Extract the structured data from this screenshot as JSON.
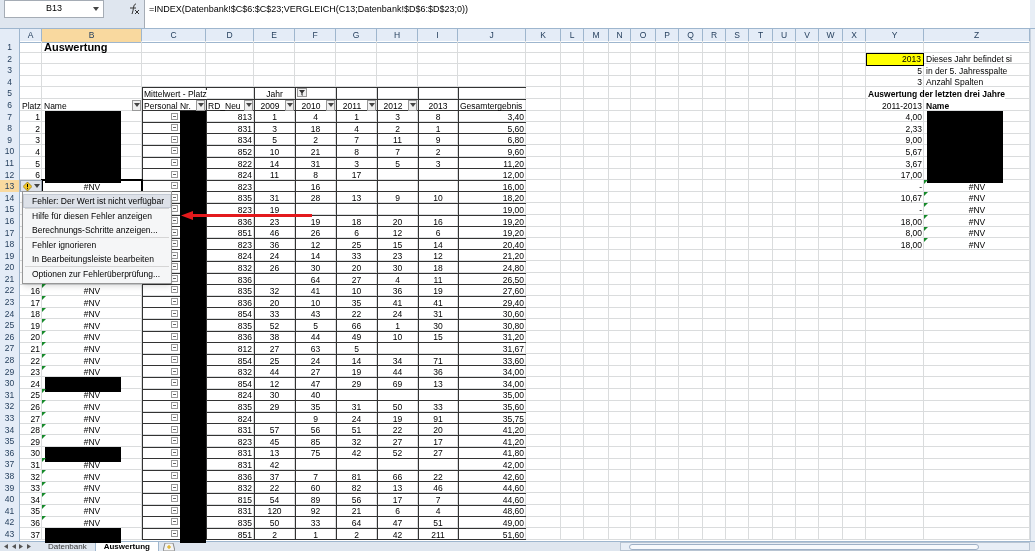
{
  "formula_bar": {
    "name_box": "B13",
    "formula": "=INDEX(Datenbank!$C$6:$C$23;VERGLEICH(C13;Datenbank!$D$6:$D$23;0))"
  },
  "columns": [
    {
      "label": "A",
      "selected": false
    },
    {
      "label": "B",
      "selected": true
    },
    {
      "label": "C",
      "selected": false
    },
    {
      "label": "D",
      "selected": false
    },
    {
      "label": "E",
      "selected": false
    },
    {
      "label": "F",
      "selected": false
    },
    {
      "label": "G",
      "selected": false
    },
    {
      "label": "H",
      "selected": false
    },
    {
      "label": "I",
      "selected": false
    },
    {
      "label": "J",
      "selected": false
    },
    {
      "label": "K",
      "selected": false
    },
    {
      "label": "L",
      "selected": false
    },
    {
      "label": "M",
      "selected": false
    },
    {
      "label": "N",
      "selected": false
    },
    {
      "label": "O",
      "selected": false
    },
    {
      "label": "P",
      "selected": false
    },
    {
      "label": "Q",
      "selected": false
    },
    {
      "label": "R",
      "selected": false
    },
    {
      "label": "S",
      "selected": false
    },
    {
      "label": "T",
      "selected": false
    },
    {
      "label": "U",
      "selected": false
    },
    {
      "label": "V",
      "selected": false
    },
    {
      "label": "W",
      "selected": false
    },
    {
      "label": "X",
      "selected": false
    },
    {
      "label": "Y",
      "selected": false
    },
    {
      "label": "Z",
      "selected": false
    }
  ],
  "row_numbers": [
    {
      "label": "1",
      "selected": false
    },
    {
      "label": "2",
      "selected": false
    },
    {
      "label": "3",
      "selected": false
    },
    {
      "label": "4",
      "selected": false
    },
    {
      "label": "5",
      "selected": false
    },
    {
      "label": "6",
      "selected": false
    },
    {
      "label": "7",
      "selected": false
    },
    {
      "label": "8",
      "selected": false
    },
    {
      "label": "9",
      "selected": false
    },
    {
      "label": "10",
      "selected": false
    },
    {
      "label": "11",
      "selected": false
    },
    {
      "label": "12",
      "selected": false
    },
    {
      "label": "13",
      "selected": true
    },
    {
      "label": "14",
      "selected": false
    },
    {
      "label": "15",
      "selected": false
    },
    {
      "label": "16",
      "selected": false
    },
    {
      "label": "17",
      "selected": false
    },
    {
      "label": "18",
      "selected": false
    },
    {
      "label": "19",
      "selected": false
    },
    {
      "label": "20",
      "selected": false
    },
    {
      "label": "21",
      "selected": false
    },
    {
      "label": "22",
      "selected": false
    },
    {
      "label": "23",
      "selected": false
    },
    {
      "label": "24",
      "selected": false
    },
    {
      "label": "25",
      "selected": false
    },
    {
      "label": "26",
      "selected": false
    },
    {
      "label": "27",
      "selected": false
    },
    {
      "label": "28",
      "selected": false
    },
    {
      "label": "29",
      "selected": false
    },
    {
      "label": "30",
      "selected": false
    },
    {
      "label": "31",
      "selected": false
    },
    {
      "label": "32",
      "selected": false
    },
    {
      "label": "33",
      "selected": false
    },
    {
      "label": "34",
      "selected": false
    },
    {
      "label": "35",
      "selected": false
    },
    {
      "label": "36",
      "selected": false
    },
    {
      "label": "37",
      "selected": false
    },
    {
      "label": "38",
      "selected": false
    },
    {
      "label": "39",
      "selected": false
    },
    {
      "label": "40",
      "selected": false
    },
    {
      "label": "41",
      "selected": false
    },
    {
      "label": "42",
      "selected": false
    },
    {
      "label": "43",
      "selected": false
    }
  ],
  "sheet": {
    "title": "Auswertung"
  },
  "pivot": {
    "header_label": "Mittelwert - Platz",
    "year_label": "Jahr",
    "fields": [
      {
        "label": "Platz",
        "dropdown": false
      },
      {
        "label": "Name",
        "dropdown": true
      },
      {
        "label": "Personal Nr.",
        "dropdown": true
      },
      {
        "label": "RD_Neu",
        "dropdown": true
      },
      {
        "label": "2009",
        "dropdown": true
      },
      {
        "label": "2010",
        "dropdown": true
      },
      {
        "label": "2011",
        "dropdown": true
      },
      {
        "label": "2012",
        "dropdown": true
      },
      {
        "label": "2013",
        "dropdown": false
      },
      {
        "label": "Gesamtergebnis",
        "dropdown": false
      }
    ]
  },
  "rows": [
    {
      "platz": "1",
      "name_redacted": true,
      "id_redacted": true,
      "rd_neu": "813",
      "year_1": "1",
      "year_2": "4",
      "year_3": "1",
      "year_4": "3",
      "year_5": "8",
      "total": "3,40"
    },
    {
      "platz": "2",
      "name_redacted": true,
      "id_redacted": true,
      "rd_neu": "831",
      "year_1": "3",
      "year_2": "18",
      "year_3": "4",
      "year_4": "2",
      "year_5": "1",
      "total": "5,60"
    },
    {
      "platz": "3",
      "name_redacted": true,
      "id_redacted": true,
      "rd_neu": "834",
      "year_1": "5",
      "year_2": "2",
      "year_3": "7",
      "year_4": "11",
      "year_5": "9",
      "total": "6,80"
    },
    {
      "platz": "4",
      "name_redacted": true,
      "id_redacted": true,
      "rd_neu": "852",
      "year_1": "10",
      "year_2": "21",
      "year_3": "8",
      "year_4": "7",
      "year_5": "2",
      "total": "9,60"
    },
    {
      "platz": "5",
      "name_redacted": true,
      "id_redacted": true,
      "rd_neu": "822",
      "year_1": "14",
      "year_2": "31",
      "year_3": "3",
      "year_4": "5",
      "year_5": "3",
      "total": "11,20"
    },
    {
      "platz": "6",
      "name_redacted": true,
      "id_redacted": true,
      "rd_neu": "824",
      "year_1": "11",
      "year_2": "8",
      "year_3": "17",
      "total": "12,00"
    },
    {
      "name": "#NV",
      "warning": false,
      "id_redacted": true,
      "rd_neu": "823",
      "year_2": "16",
      "total": "16,00"
    },
    {
      "id_redacted": true,
      "rd_neu": "835",
      "year_1": "31",
      "year_2": "28",
      "year_3": "13",
      "year_4": "9",
      "year_5": "10",
      "total": "18,20"
    },
    {
      "id_redacted": true,
      "rd_neu": "823",
      "year_1": "19",
      "total": "19,00"
    },
    {
      "id_redacted": true,
      "rd_neu": "836",
      "year_1": "23",
      "year_2": "19",
      "year_3": "18",
      "year_4": "20",
      "year_5": "16",
      "total": "19,20"
    },
    {
      "id_redacted": true,
      "rd_neu": "851",
      "year_1": "46",
      "year_2": "26",
      "year_3": "6",
      "year_4": "12",
      "year_5": "6",
      "total": "19,20"
    },
    {
      "id_redacted": true,
      "rd_neu": "823",
      "year_1": "36",
      "year_2": "12",
      "year_3": "25",
      "year_4": "15",
      "year_5": "14",
      "total": "20,40"
    },
    {
      "id_redacted": true,
      "rd_neu": "824",
      "year_1": "24",
      "year_2": "14",
      "year_3": "33",
      "year_4": "23",
      "year_5": "12",
      "total": "21,20"
    },
    {
      "id_redacted": true,
      "rd_neu": "832",
      "year_1": "26",
      "year_2": "30",
      "year_3": "20",
      "year_4": "30",
      "year_5": "18",
      "total": "24,80"
    },
    {
      "id_redacted": true,
      "rd_neu": "836",
      "year_2": "64",
      "year_3": "27",
      "year_4": "4",
      "year_5": "11",
      "total": "26,50"
    },
    {
      "platz": "16",
      "name": "#NV",
      "warning": true,
      "id_redacted": true,
      "rd_neu": "835",
      "year_1": "32",
      "year_2": "41",
      "year_3": "10",
      "year_4": "36",
      "year_5": "19",
      "total": "27,60"
    },
    {
      "platz": "17",
      "name": "#NV",
      "warning": true,
      "id_redacted": true,
      "rd_neu": "836",
      "year_1": "20",
      "year_2": "10",
      "year_3": "35",
      "year_4": "41",
      "year_5": "41",
      "total": "29,40"
    },
    {
      "platz": "18",
      "name": "#NV",
      "warning": true,
      "id_redacted": true,
      "rd_neu": "854",
      "year_1": "33",
      "year_2": "43",
      "year_3": "22",
      "year_4": "24",
      "year_5": "31",
      "total": "30,60"
    },
    {
      "platz": "19",
      "name": "#NV",
      "warning": true,
      "id_redacted": true,
      "rd_neu": "835",
      "year_1": "52",
      "year_2": "5",
      "year_3": "66",
      "year_4": "1",
      "year_5": "30",
      "total": "30,80"
    },
    {
      "platz": "20",
      "name": "#NV",
      "warning": true,
      "id_redacted": true,
      "rd_neu": "836",
      "year_1": "38",
      "year_2": "44",
      "year_3": "49",
      "year_4": "10",
      "year_5": "15",
      "total": "31,20"
    },
    {
      "platz": "21",
      "name": "#NV",
      "warning": true,
      "id_redacted": true,
      "rd_neu": "812",
      "year_1": "27",
      "year_2": "63",
      "year_3": "5",
      "total": "31,67"
    },
    {
      "platz": "22",
      "name": "#NV",
      "warning": true,
      "id_redacted": true,
      "rd_neu": "854",
      "year_1": "25",
      "year_2": "24",
      "year_3": "14",
      "year_4": "34",
      "year_5": "71",
      "total": "33,60"
    },
    {
      "platz": "23",
      "name": "#NV",
      "warning": true,
      "id_redacted": true,
      "rd_neu": "832",
      "year_1": "44",
      "year_2": "27",
      "year_3": "19",
      "year_4": "44",
      "year_5": "36",
      "total": "34,00"
    },
    {
      "platz": "24",
      "name_redacted": true,
      "id_redacted": true,
      "rd_neu": "854",
      "year_1": "12",
      "year_2": "47",
      "year_3": "29",
      "year_4": "69",
      "year_5": "13",
      "total": "34,00"
    },
    {
      "platz": "25",
      "name": "#NV",
      "warning": true,
      "id_redacted": true,
      "rd_neu": "824",
      "year_1": "30",
      "year_2": "40",
      "total": "35,00"
    },
    {
      "platz": "26",
      "name": "#NV",
      "warning": true,
      "id_redacted": true,
      "rd_neu": "835",
      "year_1": "29",
      "year_2": "35",
      "year_3": "31",
      "year_4": "50",
      "year_5": "33",
      "total": "35,60"
    },
    {
      "platz": "27",
      "name": "#NV",
      "warning": true,
      "id_redacted": true,
      "rd_neu": "824",
      "year_2": "9",
      "year_3": "24",
      "year_4": "19",
      "year_5": "91",
      "total": "35,75"
    },
    {
      "platz": "28",
      "name": "#NV",
      "warning": true,
      "id_redacted": true,
      "rd_neu": "831",
      "year_1": "57",
      "year_2": "56",
      "year_3": "51",
      "year_4": "22",
      "year_5": "20",
      "total": "41,20"
    },
    {
      "platz": "29",
      "name": "#NV",
      "warning": true,
      "id_redacted": true,
      "rd_neu": "823",
      "year_1": "45",
      "year_2": "85",
      "year_3": "32",
      "year_4": "27",
      "year_5": "17",
      "total": "41,20"
    },
    {
      "platz": "30",
      "name_redacted": true,
      "id_redacted": true,
      "rd_neu": "831",
      "year_1": "13",
      "year_2": "75",
      "year_3": "42",
      "year_4": "52",
      "year_5": "27",
      "total": "41,80"
    },
    {
      "platz": "31",
      "name": "#NV",
      "warning": true,
      "id_redacted": true,
      "rd_neu": "831",
      "year_1": "42",
      "total": "42,00"
    },
    {
      "platz": "32",
      "name": "#NV",
      "warning": true,
      "id_redacted": true,
      "rd_neu": "836",
      "year_1": "37",
      "year_2": "7",
      "year_3": "81",
      "year_4": "66",
      "year_5": "22",
      "total": "42,60"
    },
    {
      "platz": "33",
      "name": "#NV",
      "warning": true,
      "id_redacted": true,
      "rd_neu": "832",
      "year_1": "22",
      "year_2": "60",
      "year_3": "82",
      "year_4": "13",
      "year_5": "46",
      "total": "44,60"
    },
    {
      "platz": "34",
      "name": "#NV",
      "warning": true,
      "id_redacted": true,
      "rd_neu": "815",
      "year_1": "54",
      "year_2": "89",
      "year_3": "56",
      "year_4": "17",
      "year_5": "7",
      "total": "44,60"
    },
    {
      "platz": "35",
      "name": "#NV",
      "warning": true,
      "id_redacted": true,
      "rd_neu": "831",
      "year_1": "120",
      "year_2": "92",
      "year_3": "21",
      "year_4": "6",
      "year_5": "4",
      "total": "48,60"
    },
    {
      "platz": "36",
      "name": "#NV",
      "warning": true,
      "id_redacted": true,
      "rd_neu": "835",
      "year_1": "50",
      "year_2": "33",
      "year_3": "64",
      "year_4": "47",
      "year_5": "51",
      "total": "49,00"
    },
    {
      "platz": "37",
      "name_redacted": true,
      "id_redacted": true,
      "rd_neu": "851",
      "year_1": "2",
      "year_2": "1",
      "year_3": "2",
      "year_4": "42",
      "year_5": "211",
      "total": "51,60"
    }
  ],
  "side": {
    "year": "2013",
    "year_note": "Dieses Jahr befindet si",
    "column": "5",
    "column_note": "in der 5. Jahresspalte",
    "count": "3",
    "count_note": "Anzahl Spalten",
    "heading": "Auswertung der letzten drei Jahre",
    "range_label": "2011-2013",
    "name_label": "Name",
    "rows": [
      {
        "value": "4,00",
        "redacted": true
      },
      {
        "value": "2,33",
        "redacted": true
      },
      {
        "value": "9,00",
        "redacted": true
      },
      {
        "value": "5,67",
        "redacted": true
      },
      {
        "value": "3,67",
        "redacted": true
      },
      {
        "value": "17,00",
        "redacted": true
      },
      {
        "value": "-",
        "name": "#NV",
        "warning": true
      },
      {
        "value": "10,67",
        "name": "#NV",
        "warning": true
      },
      {
        "value": "-",
        "name": "#NV",
        "warning": true
      },
      {
        "value": "18,00",
        "name": "#NV",
        "warning": true
      },
      {
        "value": "8,00",
        "name": "#NV",
        "warning": true
      },
      {
        "value": "18,00",
        "name": "#NV",
        "warning": true
      }
    ]
  },
  "context_menu": {
    "items": [
      {
        "label": "Fehler: Der Wert ist nicht verfügbar",
        "selected": true,
        "separator_before": false
      },
      {
        "label": "Hilfe für diesen Fehler anzeigen",
        "selected": false,
        "separator_before": true
      },
      {
        "label": "Berechnungs-Schritte anzeigen...",
        "selected": false,
        "separator_before": false
      },
      {
        "label": "Fehler ignorieren",
        "selected": false,
        "separator_before": true
      },
      {
        "label": "In Bearbeitungsleiste bearbeiten",
        "selected": false,
        "separator_before": false
      },
      {
        "label": "Optionen zur Fehlerüberprüfung...",
        "selected": false,
        "separator_before": true
      }
    ]
  },
  "sheet_tabs": [
    {
      "label": "Datenbank",
      "selected": false
    },
    {
      "label": "Auswertung",
      "selected": true
    }
  ]
}
